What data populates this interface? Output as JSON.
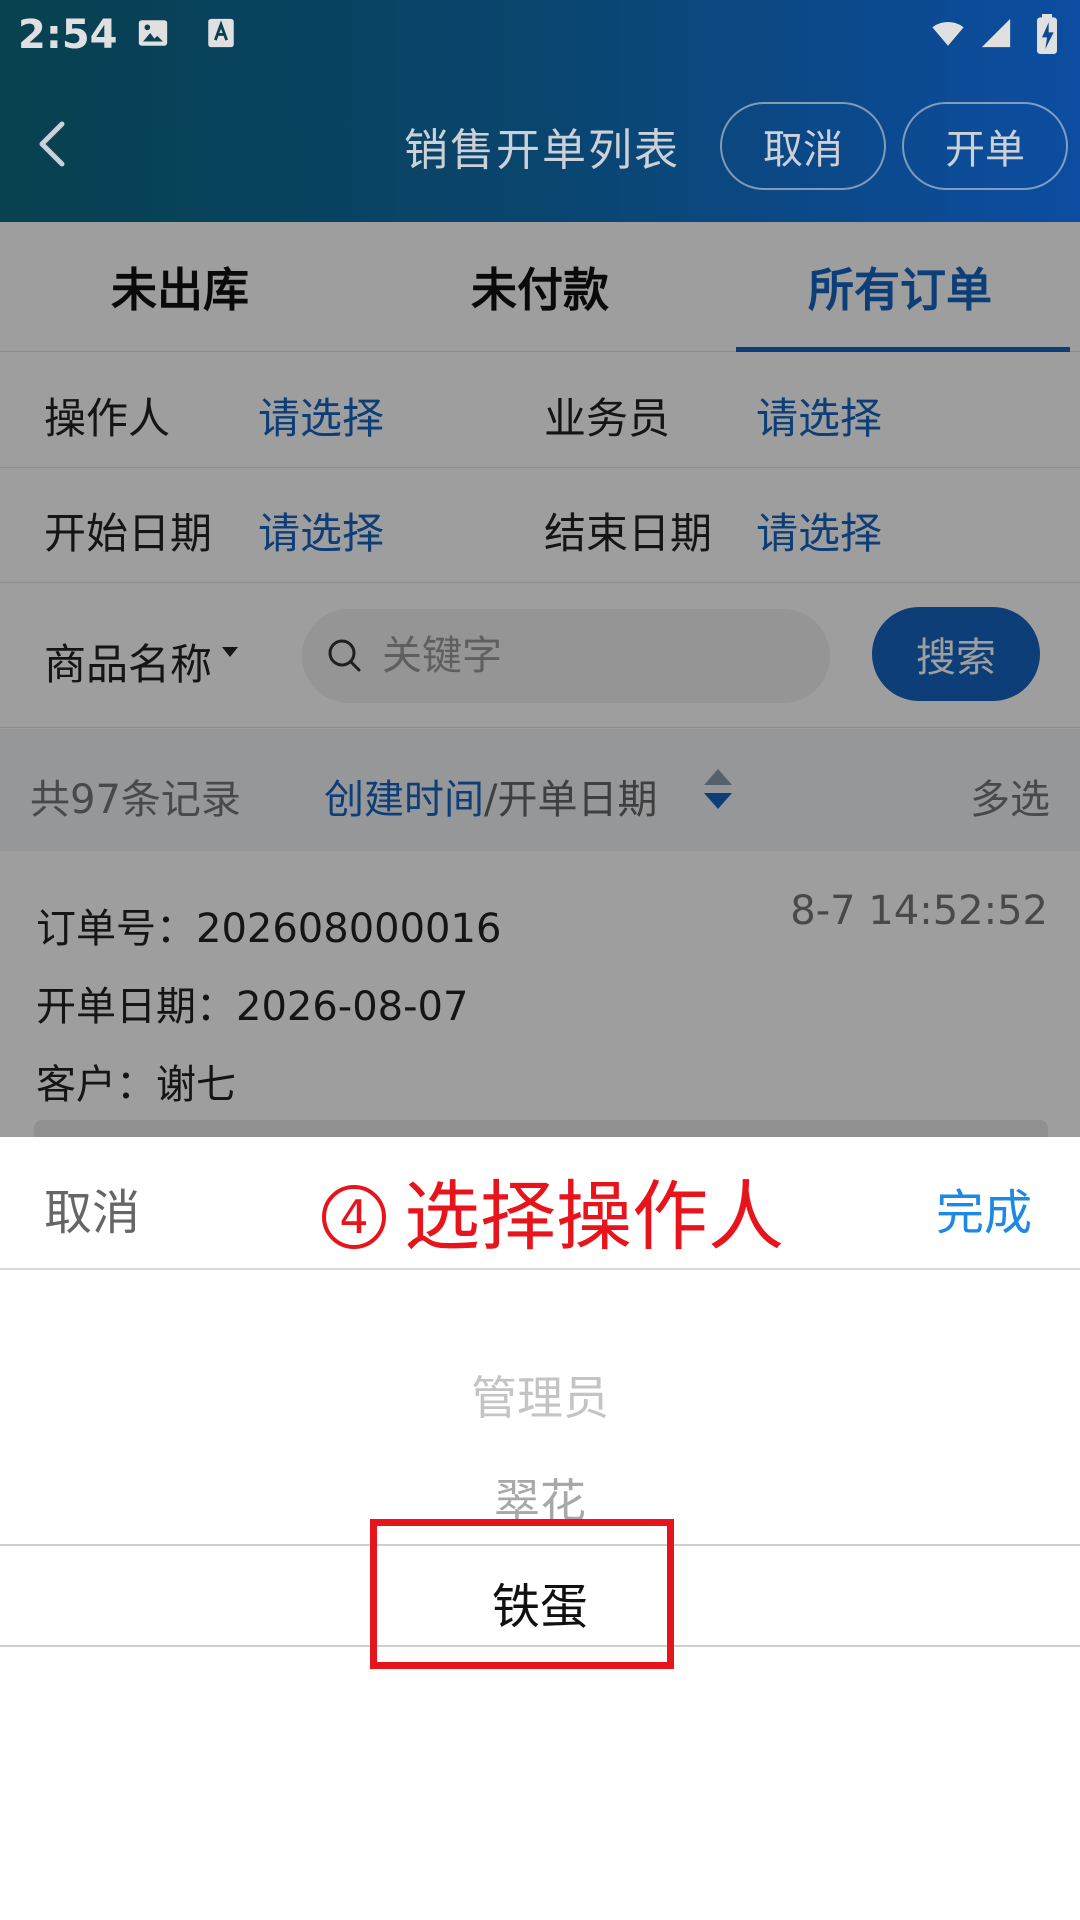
{
  "status_bar": {
    "time": "2:54"
  },
  "nav": {
    "title": "销售开单列表",
    "cancel_label": "取消",
    "open_label": "开单"
  },
  "tabs": [
    {
      "label": "未出库"
    },
    {
      "label": "未付款"
    },
    {
      "label": "所有订单",
      "active": true
    }
  ],
  "filters": {
    "operator_label": "操作人",
    "operator_value": "请选择",
    "salesman_label": "业务员",
    "salesman_value": "请选择",
    "start_date_label": "开始日期",
    "start_date_value": "请选择",
    "end_date_label": "结束日期",
    "end_date_value": "请选择"
  },
  "search": {
    "field_label": "商品名称",
    "placeholder": "关键字",
    "button_label": "搜索"
  },
  "records": {
    "count_text": "共97条记录",
    "sort_active": "创建时间",
    "sort_separator": "/",
    "sort_other": "开单日期",
    "multi_select": "多选"
  },
  "order": {
    "order_no": "订单号：202608000016",
    "open_date": "开单日期：2026-08-07",
    "customer": "客户：谢七",
    "time": "8-7 14:52:52"
  },
  "picker": {
    "cancel_label": "取消",
    "step_number": "4",
    "title": "选择操作人",
    "done_label": "完成",
    "options": [
      "管理员",
      "翠花",
      "铁蛋"
    ],
    "selected": "铁蛋"
  },
  "colors": {
    "accent": "#1565c0",
    "annotation": "#e8141b",
    "done": "#1e88e5"
  }
}
